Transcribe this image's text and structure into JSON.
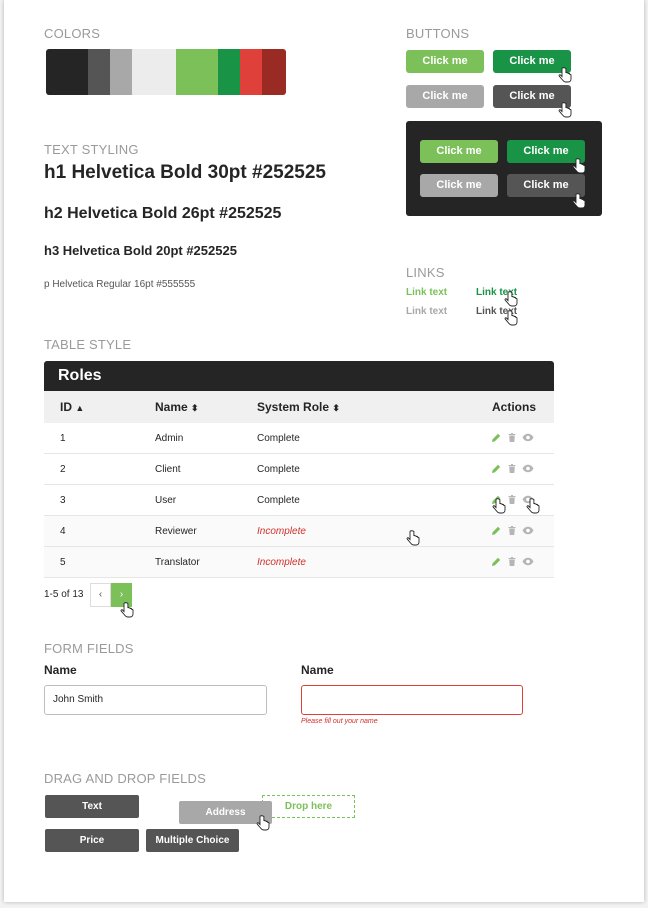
{
  "sections": {
    "colors": "COLORS",
    "buttons": "BUTTONS",
    "text_styling": "TEXT STYLING",
    "links": "LINKS",
    "table_style": "TABLE STYLE",
    "form_fields": "FORM FIELDS",
    "drag_drop": "DRAG AND DROP FIELDS"
  },
  "colors": [
    "#252525",
    "#555555",
    "#a8a8a8",
    "#ececec",
    "#7cc05a",
    "#199447",
    "#e0403a",
    "#9a2a24"
  ],
  "buttons": {
    "label": "Click me"
  },
  "text": {
    "h1": "h1 Helvetica Bold 30pt #252525",
    "h2": "h2 Helvetica Bold 26pt #252525",
    "h3": "h3 Helvetica Bold 20pt #252525",
    "p": "p Helvetica Regular 16pt #555555"
  },
  "links": {
    "label": "Link text"
  },
  "table": {
    "title": "Roles",
    "columns": {
      "id": "ID",
      "name": "Name",
      "role": "System Role",
      "actions": "Actions"
    },
    "rows": [
      {
        "id": "1",
        "name": "Admin",
        "role": "Complete"
      },
      {
        "id": "2",
        "name": "Client",
        "role": "Complete"
      },
      {
        "id": "3",
        "name": "User",
        "role": "Complete"
      },
      {
        "id": "4",
        "name": "Reviewer",
        "role": "Incomplete"
      },
      {
        "id": "5",
        "name": "Translator",
        "role": "Incomplete"
      }
    ],
    "pager": {
      "info": "1-5 of 13",
      "prev": "‹",
      "next": "›"
    }
  },
  "form": {
    "name_label": "Name",
    "name_value": "John Smith",
    "name_label_2": "Name",
    "error": "Please fill out your name"
  },
  "dnd": {
    "text": "Text",
    "address": "Address",
    "drop": "Drop here",
    "price": "Price",
    "multiple": "Multiple Choice"
  }
}
